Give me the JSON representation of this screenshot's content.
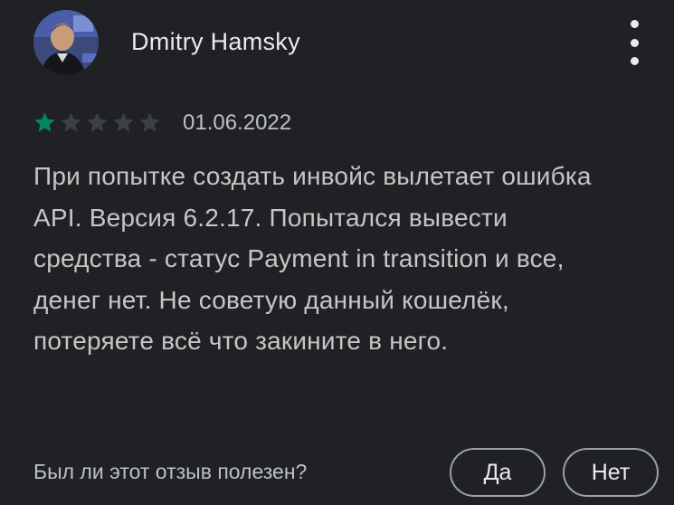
{
  "review": {
    "author": "Dmitry Hamsky",
    "rating": 1,
    "max_rating": 5,
    "date": "01.06.2022",
    "text": "При попытке создать инвойс вылетает ошибка API. Версия 6.2.17. Попытался вывести средства - статус Payment in transition и все, денег нет. Не советую данный кошелёк, потеряете всё что закините в него."
  },
  "helpful": {
    "question": "Был ли этот отзыв полезен?",
    "yes_label": "Да",
    "no_label": "Нет"
  },
  "colors": {
    "background": "#202124",
    "star_filled": "#01875f",
    "star_empty": "#3c4043",
    "text_primary": "#e8eaed",
    "text_secondary": "#bdc1c6",
    "button_border": "#9aa0a6"
  },
  "icons": {
    "menu": "more-vert-icon",
    "star": "star-icon"
  }
}
